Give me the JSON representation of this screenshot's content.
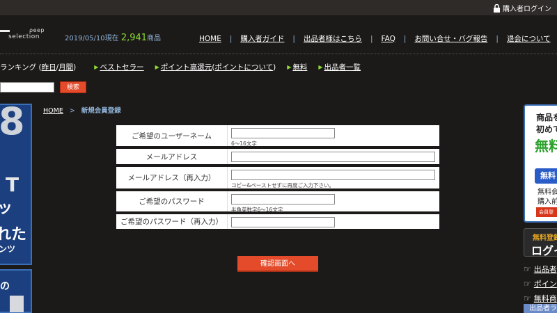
{
  "topbar": {
    "login_label": "購入者ログイン"
  },
  "logo": {
    "line1": "ρeep",
    "line2": "selection"
  },
  "header": {
    "date_label": "2019/05/10現在",
    "count": "2,941",
    "unit": "商品"
  },
  "gnav": [
    {
      "label": "HOME"
    },
    {
      "label": "購入者ガイド"
    },
    {
      "label": "出品者様はこちら"
    },
    {
      "label": "FAQ"
    },
    {
      "label": "お問い合せ・バグ報告"
    },
    {
      "label": "退会について"
    }
  ],
  "subnav": {
    "ranking_prefix": "ランキング (",
    "ranking_yesterday": "昨日",
    "ranking_sep": " / ",
    "ranking_monthly": "月間",
    "ranking_suffix": ")",
    "bestseller": "ベストセラー",
    "points": "ポイント高還元",
    "points_about_open": " (",
    "points_about": "ポイントについて",
    "points_about_close": ")",
    "free": "無料",
    "sellers": "出品者一覧"
  },
  "search": {
    "placeholder": "",
    "button": "検索"
  },
  "left_banner": {
    "num": "8",
    "letter": "T",
    "text1": "ッ",
    "text2": "れた",
    "text3": "ンツ",
    "text4": "の"
  },
  "breadcrumb": {
    "home": "HOME",
    "sep": ">",
    "current": "新規会員登録"
  },
  "form": {
    "rows": [
      {
        "label": "ご希望のユーザーネーム",
        "value": "",
        "hint": "6～16文字"
      },
      {
        "label": "メールアドレス",
        "value": "",
        "hint": ""
      },
      {
        "label": "メールアドレス（再入力）",
        "value": "",
        "hint": "コピー&ペーストせずに再度ご入力下さい。"
      },
      {
        "label": "ご希望のパスワード",
        "value": "",
        "hint": "半角英数字6～16文字"
      },
      {
        "label": "ご希望のパスワード（再入力）",
        "value": "",
        "hint": ""
      }
    ],
    "confirm_button": "確認画面へ"
  },
  "right_box": {
    "line1": "商品を",
    "line2": "初めて",
    "line3": "無料",
    "button": "無料",
    "line4": "無料会",
    "line5": "購入前",
    "small": "会員登"
  },
  "right_box2": {
    "line1": "無料登録",
    "line2": "ログイ"
  },
  "right_links": [
    {
      "label": "出品者"
    },
    {
      "label": "ポイン"
    },
    {
      "label": "無料商"
    }
  ],
  "right_bar": {
    "label": "出品者ラ"
  }
}
